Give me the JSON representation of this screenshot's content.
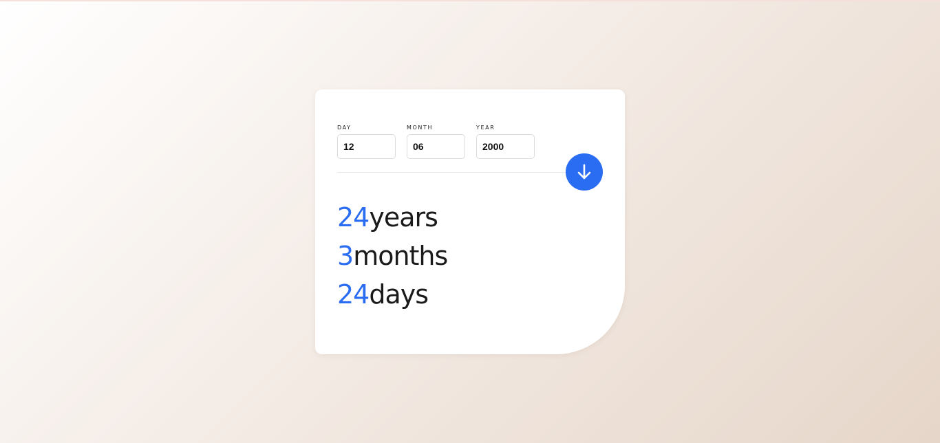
{
  "form": {
    "day": {
      "label": "DAY",
      "value": "12"
    },
    "month": {
      "label": "MONTH",
      "value": "06"
    },
    "year": {
      "label": "YEAR",
      "value": "2000"
    },
    "submit_icon": "arrow-down-icon"
  },
  "results": {
    "years": {
      "number": "24",
      "unit": "years"
    },
    "months": {
      "number": "3",
      "unit": "months"
    },
    "days": {
      "number": "24",
      "unit": "days"
    }
  },
  "colors": {
    "accent": "#2a6cf2",
    "text": "#1a1a1a",
    "card": "#ffffff"
  }
}
